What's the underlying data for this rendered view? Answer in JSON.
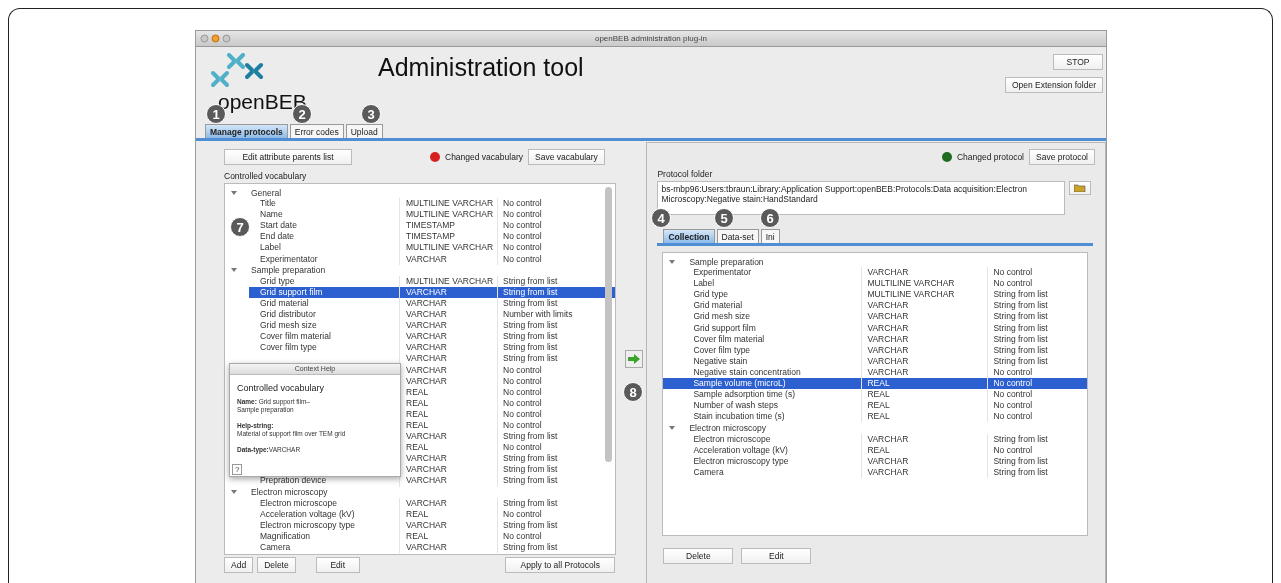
{
  "window": {
    "title": "openBEB administration plug-in"
  },
  "header": {
    "logo_text": "openBEB",
    "title": "Administration tool",
    "buttons": [
      "STOP",
      "Open Extension folder"
    ]
  },
  "tabs": [
    {
      "label": "Manage protocols",
      "selected": true
    },
    {
      "label": "Error codes",
      "selected": false
    },
    {
      "label": "Upload",
      "selected": false
    }
  ],
  "left": {
    "parents_button": "Edit attribute parents list",
    "status": {
      "label": "Changed vacabulary",
      "color": "#d62020"
    },
    "save_button": "Save vacabulary",
    "tree_label": "Controlled vocabulary",
    "groups": [
      {
        "label": "General",
        "expanded": true,
        "children": [
          {
            "name": "Title",
            "type": "MULTILINE VARCHAR",
            "control": "No control",
            "selected": false
          },
          {
            "name": "Name",
            "type": "MULTILINE VARCHAR",
            "control": "No control",
            "selected": false
          },
          {
            "name": "Start date",
            "type": "TIMESTAMP",
            "control": "No control",
            "selected": false
          },
          {
            "name": "End date",
            "type": "TIMESTAMP",
            "control": "No control",
            "selected": false
          },
          {
            "name": "Label",
            "type": "MULTILINE VARCHAR",
            "control": "No control",
            "selected": false
          },
          {
            "name": "Experimentator",
            "type": "VARCHAR",
            "control": "No control",
            "selected": false
          }
        ]
      },
      {
        "label": "Sample preparation",
        "expanded": true,
        "children": [
          {
            "name": "Grid type",
            "type": "MULTILINE VARCHAR",
            "control": "String from list",
            "selected": false
          },
          {
            "name": "Grid support film",
            "type": "VARCHAR",
            "control": "String from list",
            "selected": true
          },
          {
            "name": "Grid material",
            "type": "VARCHAR",
            "control": "String from list",
            "selected": false
          },
          {
            "name": "Grid distributor",
            "type": "VARCHAR",
            "control": "Number with limits",
            "selected": false
          },
          {
            "name": "Grid mesh size",
            "type": "VARCHAR",
            "control": "String from list",
            "selected": false
          },
          {
            "name": "Cover film material",
            "type": "VARCHAR",
            "control": "String from list",
            "selected": false
          },
          {
            "name": "Cover film type",
            "type": "VARCHAR",
            "control": "String from list",
            "selected": false
          },
          {
            "type": "VARCHAR",
            "control": "String from list",
            "selected": false
          },
          {
            "type": "VARCHAR",
            "control": "No control",
            "selected": false
          },
          {
            "type": "VARCHAR",
            "control": "No control",
            "selected": false
          },
          {
            "type": "REAL",
            "control": "No control",
            "selected": false
          },
          {
            "type": "REAL",
            "control": "No control",
            "selected": false
          },
          {
            "type": "REAL",
            "control": "No control",
            "selected": false
          },
          {
            "type": "REAL",
            "control": "No control",
            "selected": false
          },
          {
            "type": "VARCHAR",
            "control": "String from list",
            "selected": false
          },
          {
            "type": "REAL",
            "control": "No control",
            "selected": false
          },
          {
            "type": "VARCHAR",
            "control": "String from list",
            "selected": false
          },
          {
            "type": "VARCHAR",
            "control": "String from list",
            "selected": false
          },
          {
            "name": "Prepration device",
            "type": "VARCHAR",
            "control": "String from list",
            "selected": false
          }
        ]
      },
      {
        "label": "Electron microscopy",
        "expanded": true,
        "children": [
          {
            "name": "Electron microscope",
            "type": "VARCHAR",
            "control": "String from list",
            "selected": false
          },
          {
            "name": "Acceleration voltage (kV)",
            "type": "REAL",
            "control": "No control",
            "selected": false
          },
          {
            "name": "Electron microscopy type",
            "type": "VARCHAR",
            "control": "String from list",
            "selected": false
          },
          {
            "name": "Magnification",
            "type": "REAL",
            "control": "No control",
            "selected": false
          },
          {
            "name": "Camera",
            "type": "VARCHAR",
            "control": "String from list",
            "selected": false
          }
        ]
      }
    ],
    "buttons": [
      "Add",
      "Delete",
      "Edit"
    ],
    "apply_button": "Apply to all Protocols"
  },
  "right": {
    "status": {
      "label": "Changed protocol",
      "color": "#1f6b1f"
    },
    "save_button": "Save protocol",
    "folder_label": "Protocol folder",
    "folder_value": "bs-mbp96:Users:tbraun:Library:Application Support:openBEB:Protocols:Data acquisition:Electron Microscopy:Negative stain:HandStandard",
    "tabs": [
      {
        "label": "Collection",
        "selected": true
      },
      {
        "label": "Data-set",
        "selected": false
      },
      {
        "label": "Ini",
        "selected": false
      }
    ],
    "groups": [
      {
        "label": "Sample preparation",
        "expanded": true,
        "children": [
          {
            "name": "Experimentator",
            "type": "VARCHAR",
            "control": "No control",
            "selected": false
          },
          {
            "name": "Label",
            "type": "MULTILINE VARCHAR",
            "control": "No control",
            "selected": false
          },
          {
            "name": "Grid type",
            "type": "MULTILINE VARCHAR",
            "control": "String from list",
            "selected": false
          },
          {
            "name": "Grid material",
            "type": "VARCHAR",
            "control": "String from list",
            "selected": false
          },
          {
            "name": "Grid mesh size",
            "type": "VARCHAR",
            "control": "String from list",
            "selected": false
          },
          {
            "name": "Grid support film",
            "type": "VARCHAR",
            "control": "String from list",
            "selected": false
          },
          {
            "name": "Cover film material",
            "type": "VARCHAR",
            "control": "String from list",
            "selected": false
          },
          {
            "name": "Cover film type",
            "type": "VARCHAR",
            "control": "String from list",
            "selected": false
          },
          {
            "name": "Negative stain",
            "type": "VARCHAR",
            "control": "String from list",
            "selected": false
          },
          {
            "name": "Negative stain concentration",
            "type": "VARCHAR",
            "control": "No control",
            "selected": false
          },
          {
            "name": "Sample volume (microL)",
            "type": "REAL",
            "control": "No control",
            "selected": true
          },
          {
            "name": "Sample adsorption time (s)",
            "type": "REAL",
            "control": "No control",
            "selected": false
          },
          {
            "name": "Number of wash steps",
            "type": "REAL",
            "control": "No control",
            "selected": false
          },
          {
            "name": "Stain incubation time (s)",
            "type": "REAL",
            "control": "No control",
            "selected": false
          }
        ]
      },
      {
        "label": "Electron microscopy",
        "expanded": true,
        "children": [
          {
            "name": "Electron microscope",
            "type": "VARCHAR",
            "control": "String from list",
            "selected": false
          },
          {
            "name": "Acceleration voltage (kV)",
            "type": "REAL",
            "control": "No control",
            "selected": false
          },
          {
            "name": "Electron microscopy type",
            "type": "VARCHAR",
            "control": "String from list",
            "selected": false
          },
          {
            "name": "Camera",
            "type": "VARCHAR",
            "control": "String from list",
            "selected": false
          }
        ]
      }
    ],
    "buttons": [
      "Delete",
      "Edit"
    ]
  },
  "context_help": {
    "title": "Context Help",
    "heading": "Controlled vocabulary",
    "paragraphs": [
      "**Name:** Grid support film–\nSample preparation",
      "**Help-string:**\nMaterial of support film over TEM grid",
      "**Data-type:**VARCHAR"
    ],
    "help_key": "?"
  },
  "callouts": [
    "1",
    "2",
    "3",
    "7",
    "4",
    "5",
    "6",
    "8"
  ]
}
